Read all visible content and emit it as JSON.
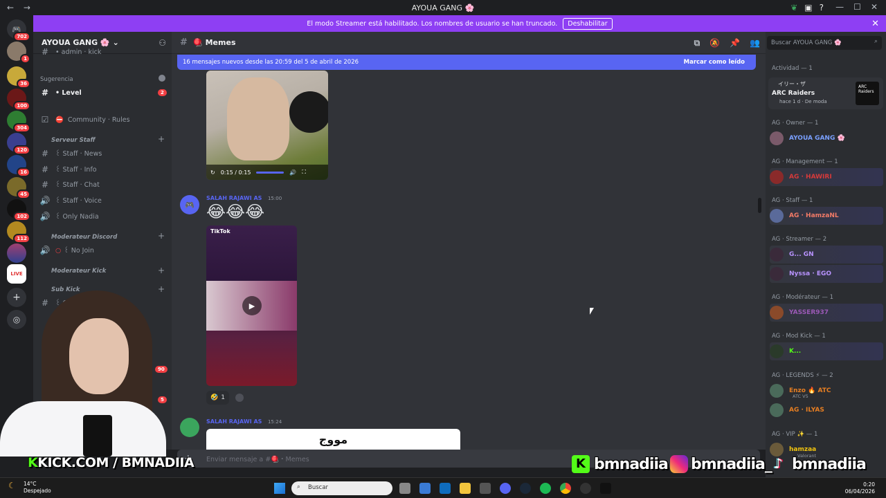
{
  "window": {
    "title": "AYOUA GANG 🌸",
    "nav_back": "←",
    "nav_forward": "→",
    "minimize": "—",
    "maximize": "☐",
    "close": "✕"
  },
  "banner": {
    "text": "El modo Streamer está habilitado. Los nombres de usuario se han truncado.",
    "button": "Deshabilitar",
    "close": "✕"
  },
  "rail": {
    "badges": [
      "702",
      "1",
      "36",
      "100",
      "304",
      "120",
      "16",
      "45",
      "102",
      "112"
    ]
  },
  "server": {
    "name": "AYOUA GANG 🌸",
    "top_partial": "• admin · kick"
  },
  "sidebar": {
    "suggestion_label": "Sugerencia",
    "suggestion_channel": "• Level",
    "suggestion_badge": "2",
    "community_rules": "Community · Rules",
    "categories": {
      "serveur_staff": "Serveur Staff",
      "moderateur_discord": "Moderateur Discord",
      "moderateur_kick": "Moderateur Kick",
      "sub_kick": "Sub Kick"
    },
    "staff_channels": [
      "꒰ Staff · News",
      "꒰ Staff · Info",
      "꒰ Staff · Chat",
      "꒰ Staff · Voice",
      "꒰ Only Nadia"
    ],
    "no_join": "꒰ No Join",
    "sub_kick_partial": "꒰ C",
    "badge_90": "90",
    "badge_5": "5"
  },
  "chat": {
    "channel_name": "Memes",
    "new_messages_text": "16 mensajes nuevos desde las 20:59 del 5 de abril de 2026",
    "mark_read": "Marcar como leído",
    "video_time": "0:15 / 0:15",
    "message1_user": "SALAH RAJAWI AS",
    "message1_time": "15:00",
    "message1_emojis": "😂😂😂",
    "tiktok_label": "TikTok",
    "reaction_emoji": "🤣",
    "reaction_count": "1",
    "message2_user": "SALAH RAJAWI AS",
    "message2_time": "15:24",
    "message2_image_text": "مووج",
    "composer_placeholder": "Enviar mensaje a #🪀・Memes"
  },
  "members": {
    "search_placeholder": "Buscar AYOUA GANG 🌸",
    "activity_header": "Actividad — 1",
    "activity_user": "イリー・ザ",
    "activity_game": "ARC Raiders",
    "activity_meta": "hace 1 d · De moda",
    "activity_cover": "ARC Raiders",
    "groups": [
      {
        "label": "AG · Owner — 1",
        "members": [
          {
            "name": "AYOUA GANG 🌸",
            "color": "#7aa0ff"
          }
        ]
      },
      {
        "label": "AG · Management — 1",
        "members": [
          {
            "name": "AG · HAWIRI",
            "color": "#d63a3a"
          }
        ]
      },
      {
        "label": "AG · Staff — 1",
        "members": [
          {
            "name": "AG · HamzaNL",
            "color": "#f47b67"
          }
        ]
      },
      {
        "label": "AG · Streamer — 2",
        "members": [
          {
            "name": "G... GN",
            "color": "#b993ff"
          },
          {
            "name": "Nyssa · EGO",
            "color": "#b993ff"
          }
        ]
      },
      {
        "label": "AG · Modérateur — 1",
        "members": [
          {
            "name": "YASSER937",
            "color": "#9b59b6"
          }
        ]
      },
      {
        "label": "AG · Mod Kick — 1",
        "members": [
          {
            "name": "K...",
            "color": "#53fc18"
          }
        ]
      },
      {
        "label": "AG · LEGENDS ⚡ — 2",
        "members": [
          {
            "name": "Enzo 🔥 ATC",
            "color": "#e67e22"
          },
          {
            "name": "AG · ILYAS",
            "color": "#e67e22"
          }
        ]
      },
      {
        "label": "AG · VIP ✨ — 1",
        "members": [
          {
            "name": "hamzaa",
            "color": "#f1c40f"
          }
        ]
      }
    ],
    "sub_atc": "ATC V5",
    "sub_valorant": "Valorant"
  },
  "overlay": {
    "kick_text": "KICK.COM / BMNADIIA",
    "kick_user": "bmnadiia",
    "instagram_user": "bmnadiia_",
    "tiktok_user": "bmnadiia"
  },
  "taskbar": {
    "temperature": "14°C",
    "weather": "Despejado",
    "search_placeholder": "Buscar",
    "time": "0:20",
    "date": "06/04/2026"
  },
  "colors": {
    "accent": "#5865f2",
    "banner": "#8e3ff3",
    "kick_green": "#53fc18"
  }
}
